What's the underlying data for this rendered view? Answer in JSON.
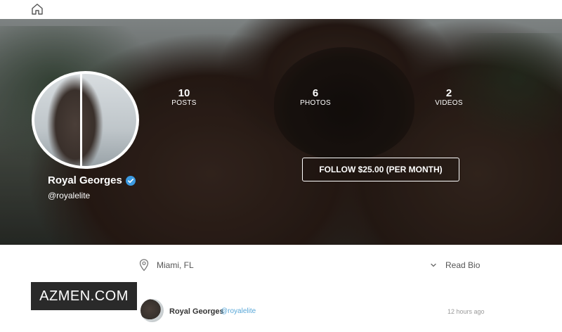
{
  "header": {
    "home_icon": "home-icon"
  },
  "profile": {
    "name": "Royal Georges",
    "handle": "@royalelite",
    "verified_icon": "verified-check-icon",
    "verified_color": "#3b9ae1"
  },
  "stats": [
    {
      "value": "10",
      "label": "POSTS"
    },
    {
      "value": "6",
      "label": "PHOTOS"
    },
    {
      "value": "2",
      "label": "VIDEOS"
    }
  ],
  "follow_button": {
    "label": "FOLLOW $25.00 (PER MONTH)"
  },
  "info": {
    "location_icon": "map-pin-icon",
    "location": "Miami, FL",
    "bio_icon": "chevron-down-icon",
    "bio_label": "Read Bio"
  },
  "watermark": {
    "text": "AZMEN.COM"
  },
  "post": {
    "author": "Royal Georges",
    "handle": "@royalelite",
    "time": "12 hours ago",
    "handle_color": "#58a7d8"
  }
}
